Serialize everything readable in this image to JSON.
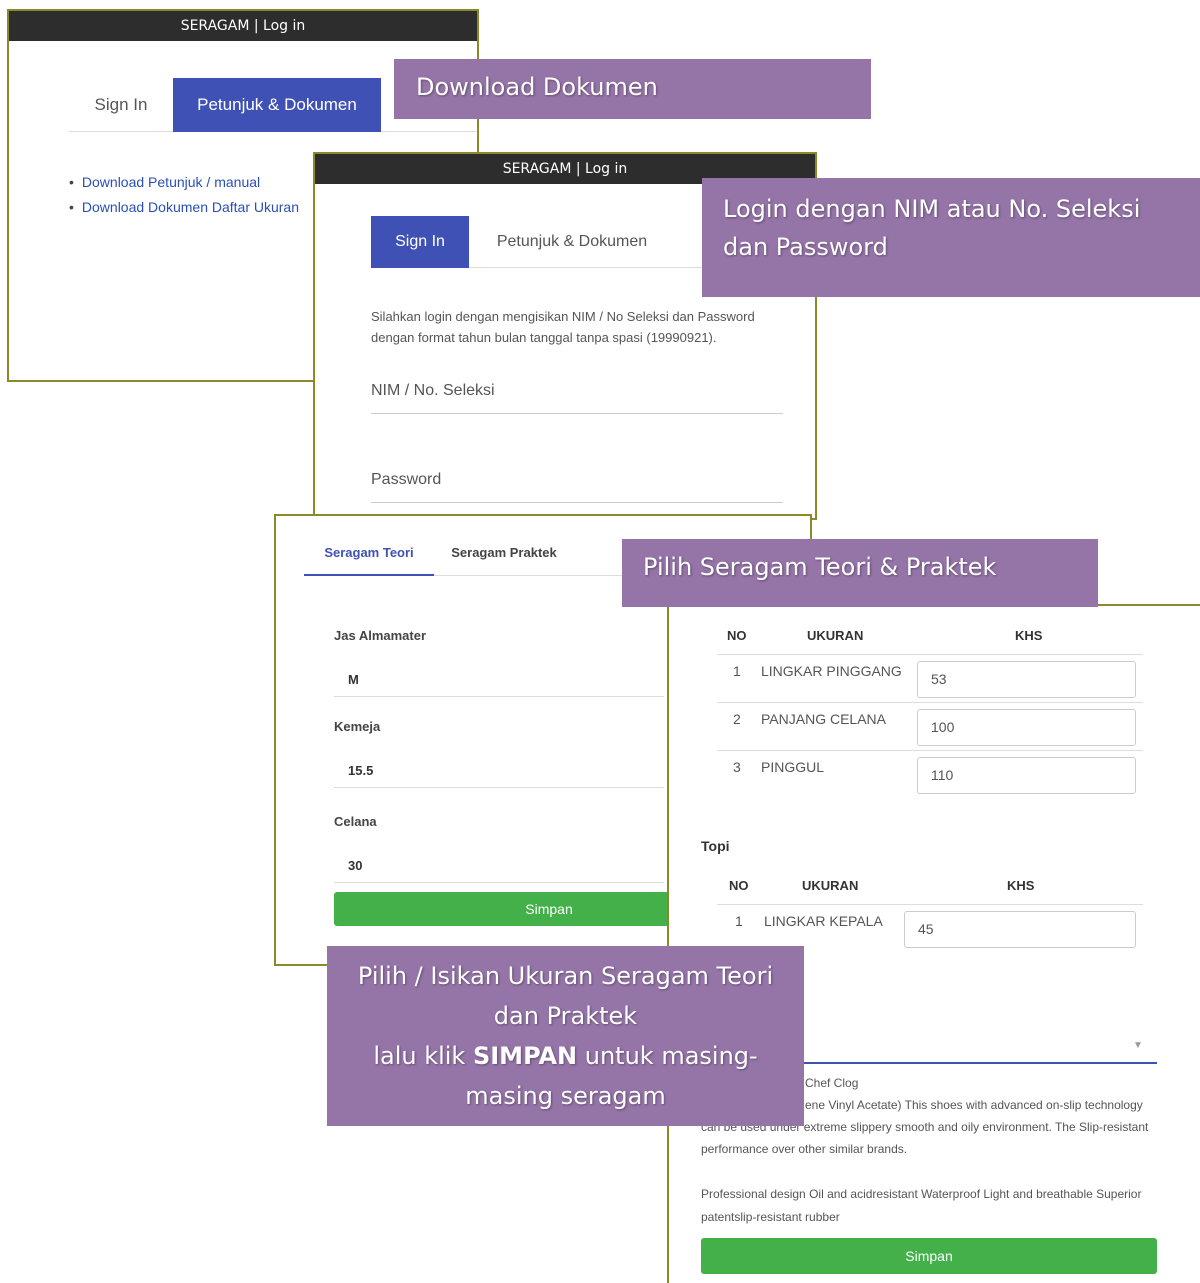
{
  "window1": {
    "titlebar": "SERAGAM | Log in",
    "tabs": [
      "Sign In",
      "Petunjuk & Dokumen"
    ],
    "links": [
      "Download Petunjuk / manual",
      "Download Dokumen Daftar Ukuran"
    ]
  },
  "window2": {
    "titlebar": "SERAGAM | Log in",
    "tabs": [
      "Sign In",
      "Petunjuk & Dokumen"
    ],
    "description": "Silahkan login dengan mengisikan NIM / No Seleksi dan Password dengan format tahun bulan tanggal tanpa spasi (19990921).",
    "nim_placeholder": "NIM / No. Seleksi",
    "password_placeholder": "Password"
  },
  "window3": {
    "tabs": [
      "Seragam Teori",
      "Seragam Praktek"
    ],
    "fields": [
      {
        "label": "Jas Almamater",
        "value": "M"
      },
      {
        "label": "Kemeja",
        "value": "15.5"
      },
      {
        "label": "Celana",
        "value": "30"
      }
    ],
    "save_label": "Simpan"
  },
  "window4": {
    "table1": {
      "headers": [
        "NO",
        "UKURAN",
        "KHS"
      ],
      "rows": [
        {
          "no": "1",
          "ukuran": "LINGKAR PINGGANG",
          "khs": "53"
        },
        {
          "no": "2",
          "ukuran": "PANJANG CELANA",
          "khs": "100"
        },
        {
          "no": "3",
          "ukuran": "PINGGUL",
          "khs": "110"
        }
      ]
    },
    "section_topi": "Topi",
    "table2": {
      "headers": [
        "NO",
        "UKURAN",
        "KHS"
      ],
      "rows": [
        {
          "no": "1",
          "ukuran": "LINGKAR KEPALA",
          "khs": "45"
        }
      ]
    },
    "product_title": "Chef Clog",
    "product_desc_line1": "ene Vinyl Acetate) This shoes with advanced on-slip technology",
    "product_desc_line2": "can be used under extreme slippery smooth and oily environment. The Slip-resistant",
    "product_desc_line3": "performance over other similar brands.",
    "product_desc2_line1": "Professional design Oil and acidresistant Waterproof Light and breathable Superior",
    "product_desc2_line2": "patentslip-resistant rubber",
    "save_label": "Simpan"
  },
  "annotations": {
    "download": "Download Dokumen",
    "login_line1": "Login dengan NIM atau No. Seleksi",
    "login_line2": "dan Password",
    "pilih": "Pilih Seragam Teori & Praktek",
    "isikan_line1": "Pilih / Isikan Ukuran Seragam Teori",
    "isikan_line2": "dan Praktek",
    "isikan_line3_pre": "lalu klik ",
    "isikan_line3_bold": "SIMPAN",
    "isikan_line3_post": " untuk masing-",
    "isikan_line4": "masing seragam"
  },
  "colors": {
    "accent": "#3f51b5",
    "save_green": "#43b04a",
    "annotation": "#9574a8",
    "titlebar": "#2d2d2d"
  }
}
